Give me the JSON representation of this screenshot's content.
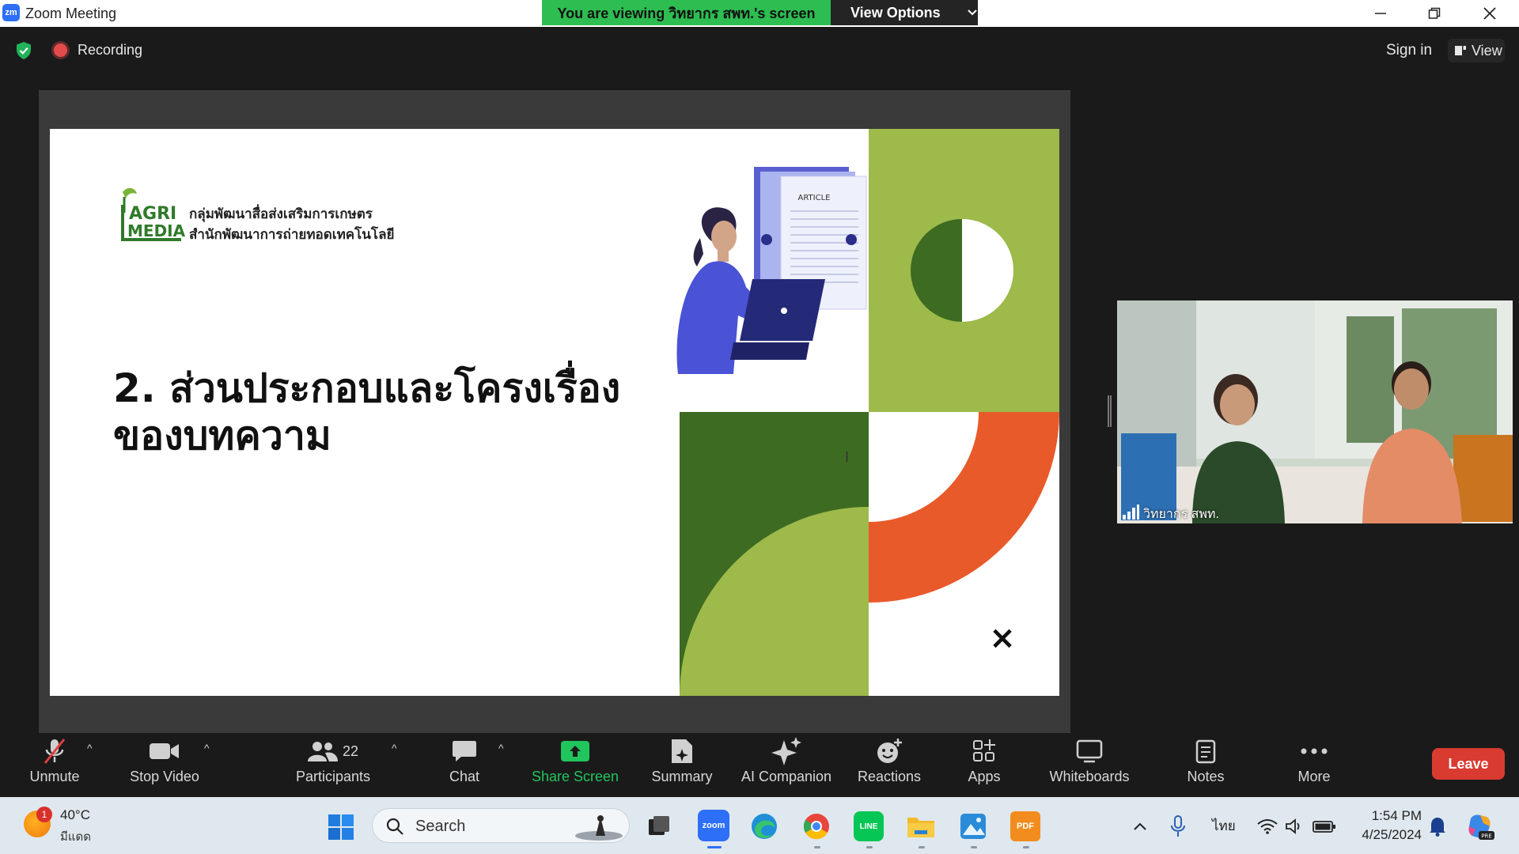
{
  "window": {
    "app_logo": "zm",
    "title": "Zoom Meeting",
    "viewing_banner": "You are viewing วิทยากร สพท.'s screen",
    "view_options_label": "View Options"
  },
  "header": {
    "recording_label": "Recording",
    "sign_in_label": "Sign in",
    "view_label": "View"
  },
  "slide": {
    "org_line1": "กลุ่มพัฒนาสื่อส่งเสริมการเกษตร",
    "org_line2": "สำนักพัฒนาการถ่ายทอดเทคโนโลยี",
    "logo_text_top": "AGRI",
    "logo_text_bottom": "MEDIA",
    "title_line1": "2. ส่วนประกอบและโครงเรื่อง",
    "title_line2": "ของบทความ",
    "article_label": "ARTICLE",
    "close_mark": "×"
  },
  "video": {
    "participant_name": "วิทยากร สพท."
  },
  "toolbar": {
    "unmute": "Unmute",
    "stop_video": "Stop Video",
    "participants": "Participants",
    "participants_count": "22",
    "chat": "Chat",
    "share_screen": "Share Screen",
    "summary": "Summary",
    "ai_companion": "AI Companion",
    "reactions": "Reactions",
    "apps": "Apps",
    "whiteboards": "Whiteboards",
    "notes": "Notes",
    "more": "More",
    "leave": "Leave"
  },
  "taskbar": {
    "weather_temp": "40°C",
    "weather_condition": "มีแดด",
    "weather_badge": "1",
    "search_placeholder": "Search",
    "language": "ไทย",
    "time": "1:54 PM",
    "date": "4/25/2024"
  },
  "colors": {
    "banner_green": "#2dbd51",
    "share_green": "#21c55d",
    "leave_red": "#d93b30",
    "slide_light_green": "#9dba4a",
    "slide_dark_green": "#3d6b22",
    "slide_orange": "#e95a2b"
  }
}
